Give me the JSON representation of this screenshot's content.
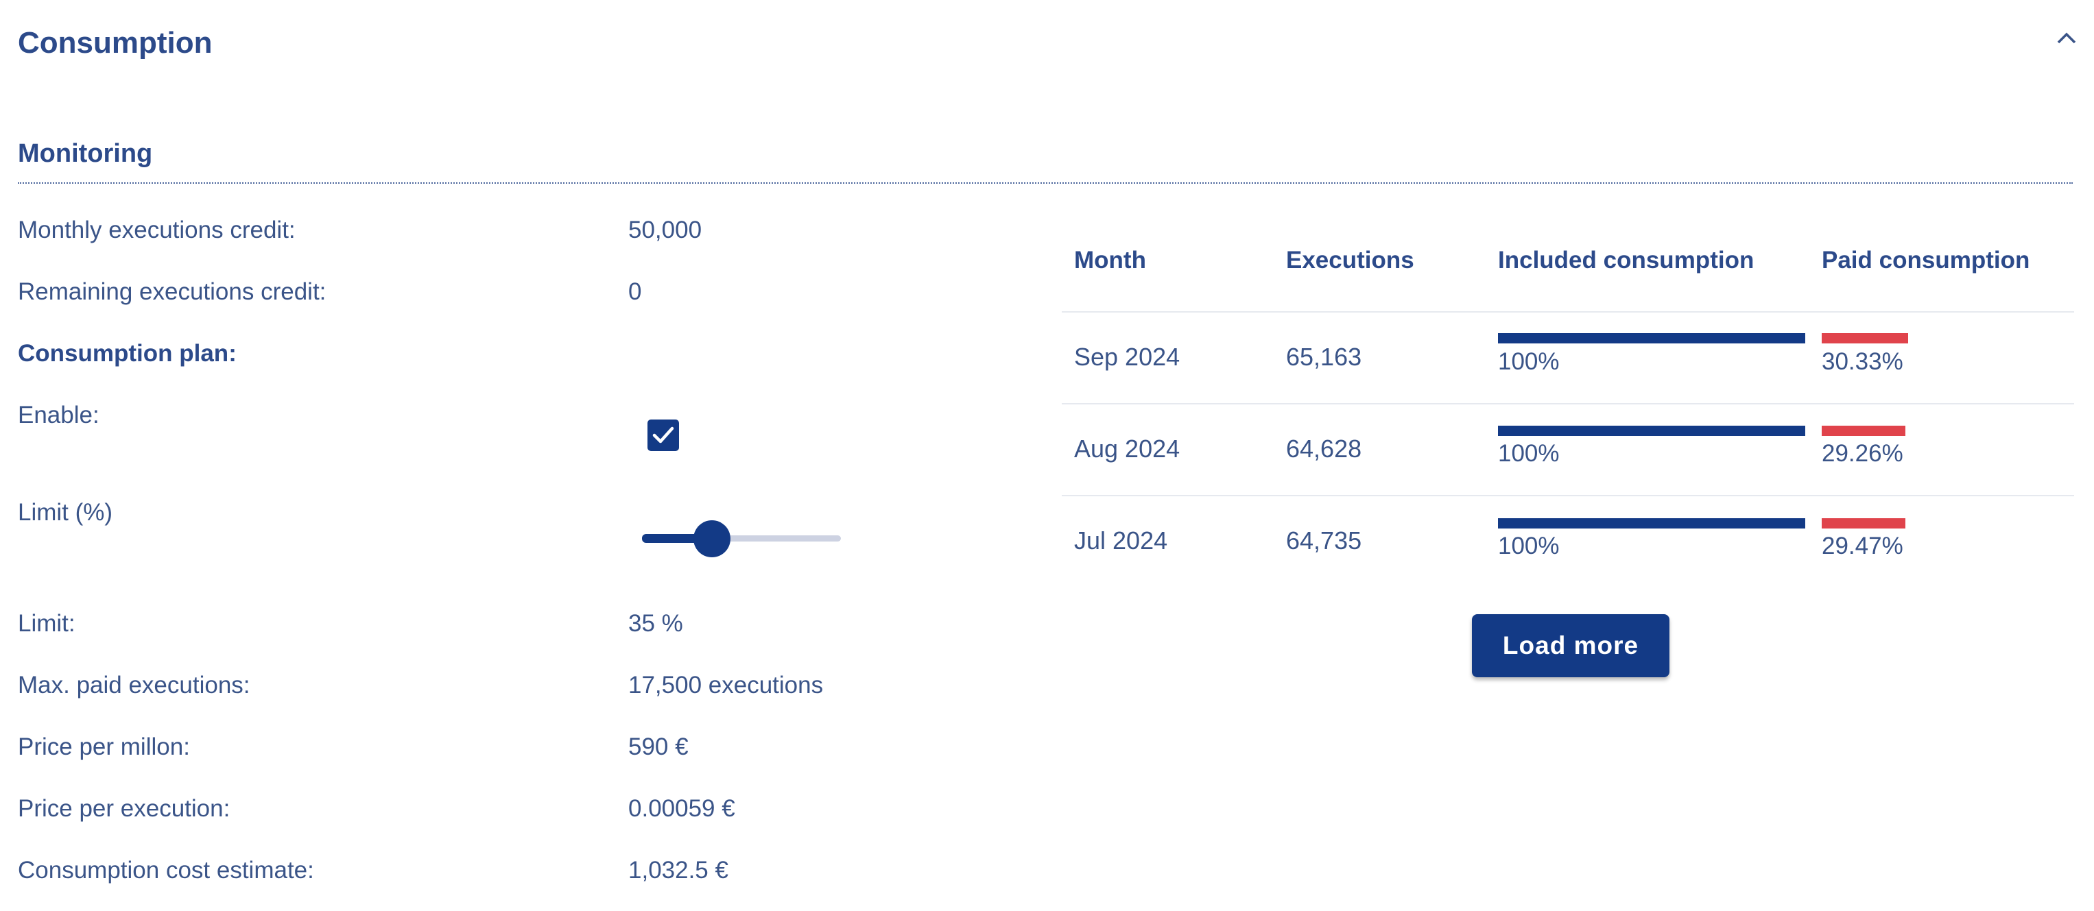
{
  "section": {
    "title": "Consumption"
  },
  "monitoring": {
    "title": "Monitoring",
    "rows": [
      {
        "label": "Monthly executions credit:",
        "value": "50,000"
      },
      {
        "label": "Remaining executions credit:",
        "value": "0"
      }
    ],
    "plan_title": "Consumption plan:",
    "enable_label": "Enable:",
    "enable_checked": true,
    "limit_slider_label": "Limit (%)",
    "limit_slider_value_percent": 35,
    "details": [
      {
        "label": "Limit:",
        "value": "35 %"
      },
      {
        "label": "Max. paid executions:",
        "value": "17,500 executions"
      },
      {
        "label": "Price per millon:",
        "value": "590 €"
      },
      {
        "label": "Price per execution:",
        "value": "0.00059 €"
      },
      {
        "label": "Consumption cost estimate:",
        "value": "1,032.5 €"
      }
    ]
  },
  "table": {
    "headers": {
      "month": "Month",
      "executions": "Executions",
      "included": "Included consumption",
      "paid": "Paid consumption"
    },
    "rows": [
      {
        "month": "Sep 2024",
        "executions": "65,163",
        "included_label": "100%",
        "included_fraction": 1.0,
        "paid_label": "30.33%",
        "paid_fraction": 0.3033
      },
      {
        "month": "Aug 2024",
        "executions": "64,628",
        "included_label": "100%",
        "included_fraction": 1.0,
        "paid_label": "29.26%",
        "paid_fraction": 0.2926
      },
      {
        "month": "Jul 2024",
        "executions": "64,735",
        "included_label": "100%",
        "included_fraction": 1.0,
        "paid_label": "29.47%",
        "paid_fraction": 0.2947
      }
    ]
  },
  "load_more_label": "Load more",
  "colors": {
    "primary": "#133a86",
    "paid": "#e0434b",
    "text": "#3a5488"
  }
}
